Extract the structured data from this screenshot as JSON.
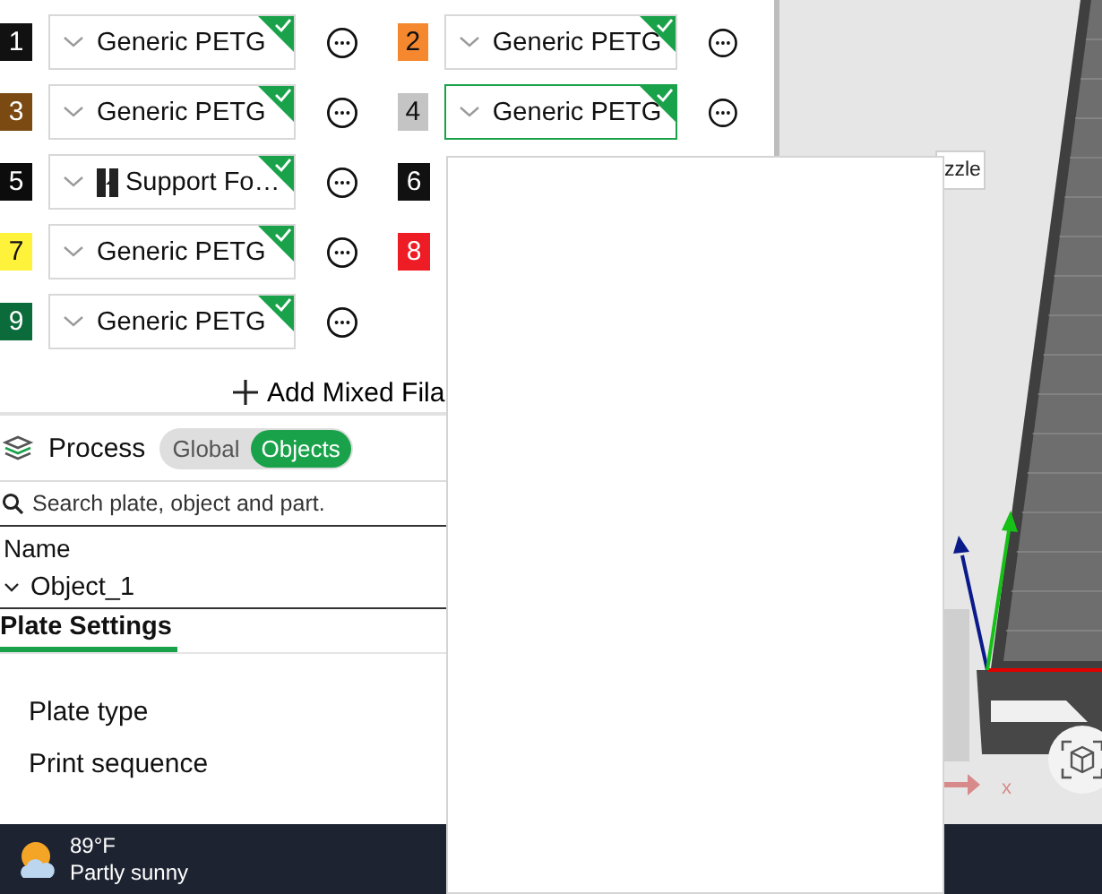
{
  "filaments": [
    {
      "index": "1",
      "color": "#111111",
      "kind": "generic",
      "name": "Generic PETG",
      "selected": false
    },
    {
      "index": "2",
      "color": "#f5882f",
      "kind": "generic",
      "name": "Generic PETG",
      "selected": false
    },
    {
      "index": "3",
      "color": "#7a4a12",
      "kind": "generic",
      "name": "Generic PETG",
      "selected": false
    },
    {
      "index": "4",
      "color": "#c4c4c4",
      "kind": "generic",
      "name": "Generic PETG",
      "selected": true
    },
    {
      "index": "5",
      "color": "#0c0c0c",
      "kind": "support",
      "name": "Support Fo…",
      "selected": false
    },
    {
      "index": "6",
      "color": "#111111",
      "kind": "hidden"
    },
    {
      "index": "7",
      "color": "#fff23a",
      "kind": "generic",
      "name": "Generic PETG",
      "selected": false
    },
    {
      "index": "8",
      "color": "#ee1c24",
      "kind": "hidden"
    },
    {
      "index": "9",
      "color": "#0b6b3a",
      "kind": "generic",
      "name": "Generic PETG",
      "selected": false
    }
  ],
  "add_button": {
    "label": "Add Mixed Fila"
  },
  "process": {
    "title": "Process",
    "toggle": [
      {
        "label": "Global",
        "selected": false
      },
      {
        "label": "Objects",
        "selected": true
      }
    ]
  },
  "search": {
    "placeholder": "Search plate, object and part."
  },
  "object_list": {
    "header": "Name",
    "items": [
      {
        "label": "Object_1",
        "expanded": true
      }
    ]
  },
  "settings_tabs": [
    {
      "label": "Plate Settings",
      "selected": true
    }
  ],
  "settings": [
    "Plate type",
    "Print sequence"
  ],
  "tooltip": {
    "text": "zzle"
  },
  "viewport": {
    "axis_label": "x"
  },
  "taskbar": {
    "temperature": "89°F",
    "condition": "Partly sunny"
  }
}
